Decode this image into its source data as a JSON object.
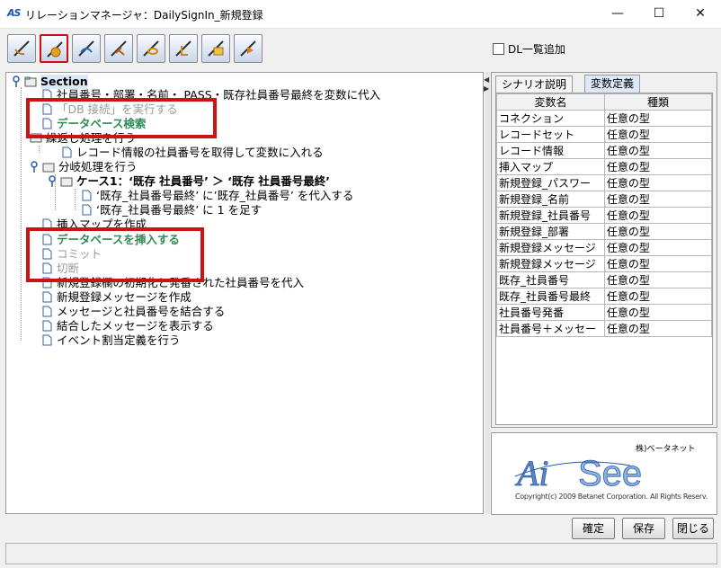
{
  "window": {
    "title": "リレーションマネージャ：DailySignIn_新規登録",
    "minimize": "—",
    "maximize": "☐",
    "close": "✕",
    "app_icon": "AS"
  },
  "toolbar": {
    "buttons": [
      "tool-1",
      "tool-2",
      "tool-3",
      "tool-4",
      "tool-5",
      "tool-6",
      "tool-7",
      "tool-8"
    ]
  },
  "dl_checkbox": {
    "label": "DL一覧追加",
    "checked": false
  },
  "tree": {
    "root": "Section",
    "items": [
      "社員番号・部署・名前・ PASS・既存社員番号最終を変数に代入",
      "「DB 接続」を実行する",
      "データベース検索",
      "繰返し処理を行う",
      "レコード情報の社員番号を取得して変数に入れる",
      "分岐処理を行う",
      "ケース1：‘既存 社員番号’ ＞ ‘既存 社員番号最終’",
      "‘既存_社員番号最終’ に’既存_社員番号’ を代入する",
      "‘既存_社員番号最終’ に 1 を足す",
      "挿入マップを作成",
      "データベースを挿入する",
      "コミット",
      "切断",
      "新規登録欄の初期化と発番された社員番号を代入",
      "新規登録メッセージを作成",
      "メッセージと社員番号を結合する",
      "結合したメッセージを表示する",
      "イベント割当定義を行う"
    ]
  },
  "tabs": [
    "シナリオ説明",
    "変数定義"
  ],
  "variables": {
    "headers": [
      "変数名",
      "種類"
    ],
    "rows": [
      [
        "コネクション",
        "任意の型"
      ],
      [
        "レコードセット",
        "任意の型"
      ],
      [
        "レコード情報",
        "任意の型"
      ],
      [
        "挿入マップ",
        "任意の型"
      ],
      [
        "新規登録_パスワー",
        "任意の型"
      ],
      [
        "新規登録_名前",
        "任意の型"
      ],
      [
        "新規登録_社員番号",
        "任意の型"
      ],
      [
        "新規登録_部署",
        "任意の型"
      ],
      [
        "新規登録メッセージ",
        "任意の型"
      ],
      [
        "新規登録メッセージ",
        "任意の型"
      ],
      [
        "既存_社員番号",
        "任意の型"
      ],
      [
        "既存_社員番号最終",
        "任意の型"
      ],
      [
        "社員番号発番",
        "任意の型"
      ],
      [
        "社員番号＋メッセー",
        "任意の型"
      ]
    ]
  },
  "logo": {
    "company": "株)ベータネット",
    "brand": "AiSee",
    "copyright": "Copyright(c) 2009 Betanet Corporation. All Rights Reserv."
  },
  "buttons": {
    "confirm": "確定",
    "save": "保存",
    "close": "閉じる"
  }
}
